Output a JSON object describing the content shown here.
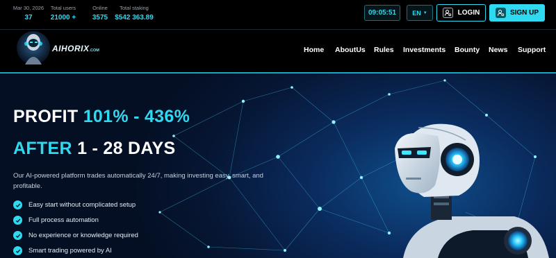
{
  "stats": {
    "date_label": "Mar 30, 2026",
    "date_value": "37",
    "users_label": "Total users",
    "users_value": "21000 +",
    "online_label": "Online",
    "online_value": "3575",
    "staking_label": "Total staking",
    "staking_value": "$542 363.89"
  },
  "header": {
    "clock": "09:05:51",
    "language": "EN",
    "login_label": "LOGIN",
    "signup_label": "SIGN UP",
    "icons": {
      "login": "user-settings-icon",
      "signup": "user-settings-icon",
      "language": "caret-down-icon"
    }
  },
  "brand": {
    "name": "AIHORIX",
    "domain": ".COM"
  },
  "nav": [
    "Home",
    "AboutUs",
    "Rules",
    "Investments",
    "Bounty",
    "News",
    "Support"
  ],
  "hero": {
    "line1": {
      "a": "PROFIT ",
      "b": "101% - 436%"
    },
    "line2": {
      "a": "AFTER ",
      "b": "1 - 28 DAYS"
    },
    "description": "Our AI-powered platform trades automatically 24/7, making investing easy, smart, and profitable.",
    "features": [
      "Easy start without complicated setup",
      "Full process automation",
      "No experience or knowledge required",
      "Smart trading powered by AI"
    ]
  },
  "colors": {
    "accent": "#2fd9ef",
    "background": "#000000",
    "hero_bg": "#061633"
  }
}
